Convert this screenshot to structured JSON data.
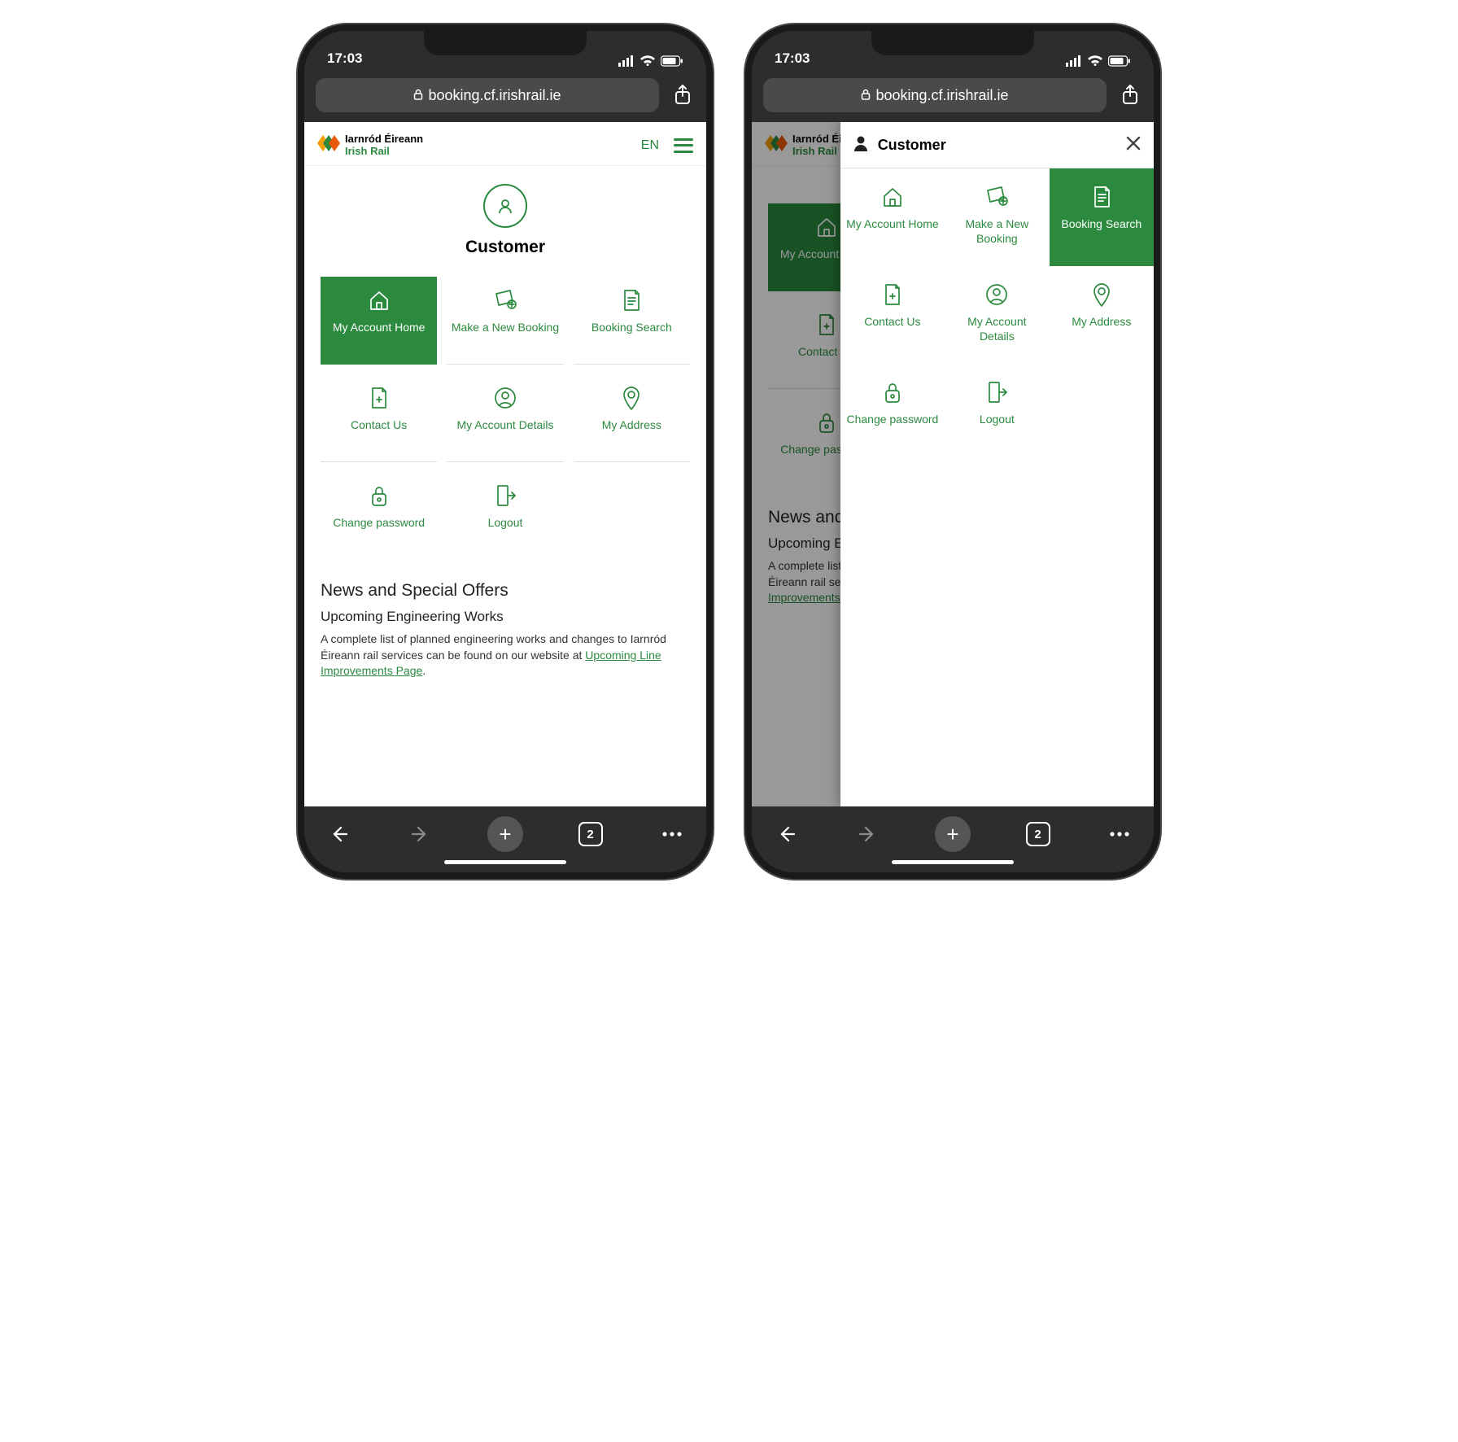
{
  "status": {
    "time": "17:03"
  },
  "url": "booking.cf.irishrail.ie",
  "header": {
    "logo_line1": "Iarnród Éireann",
    "logo_line2": "Irish Rail",
    "lang": "EN"
  },
  "customer_section": {
    "title": "Customer",
    "tiles": [
      {
        "key": "my-account-home",
        "label": "My Account Home",
        "icon": "home"
      },
      {
        "key": "make-new-booking",
        "label": "Make a New Booking",
        "icon": "ticket-plus"
      },
      {
        "key": "booking-search",
        "label": "Booking Search",
        "icon": "doc-search"
      },
      {
        "key": "contact-us",
        "label": "Contact Us",
        "icon": "doc-plus"
      },
      {
        "key": "my-account-details",
        "label": "My Account Details",
        "icon": "user-circle"
      },
      {
        "key": "my-address",
        "label": "My Address",
        "icon": "pin"
      },
      {
        "key": "change-password",
        "label": "Change password",
        "icon": "lock"
      },
      {
        "key": "logout",
        "label": "Logout",
        "icon": "logout"
      }
    ],
    "active_left": "my-account-home",
    "active_right": "booking-search"
  },
  "news": {
    "section_title": "News and Special Offers",
    "subtitle": "Upcoming Engineering Works",
    "body": "A complete list of planned engineering works and changes to Iarnród Éireann rail services can be found on our website at ",
    "link_text": "Upcoming Line Improvements Page",
    "trail": "."
  },
  "panel": {
    "title": "Customer"
  },
  "bottom": {
    "tab_count": "2"
  },
  "colors": {
    "green": "#2b8a3e",
    "dark": "#2d2d2d"
  }
}
